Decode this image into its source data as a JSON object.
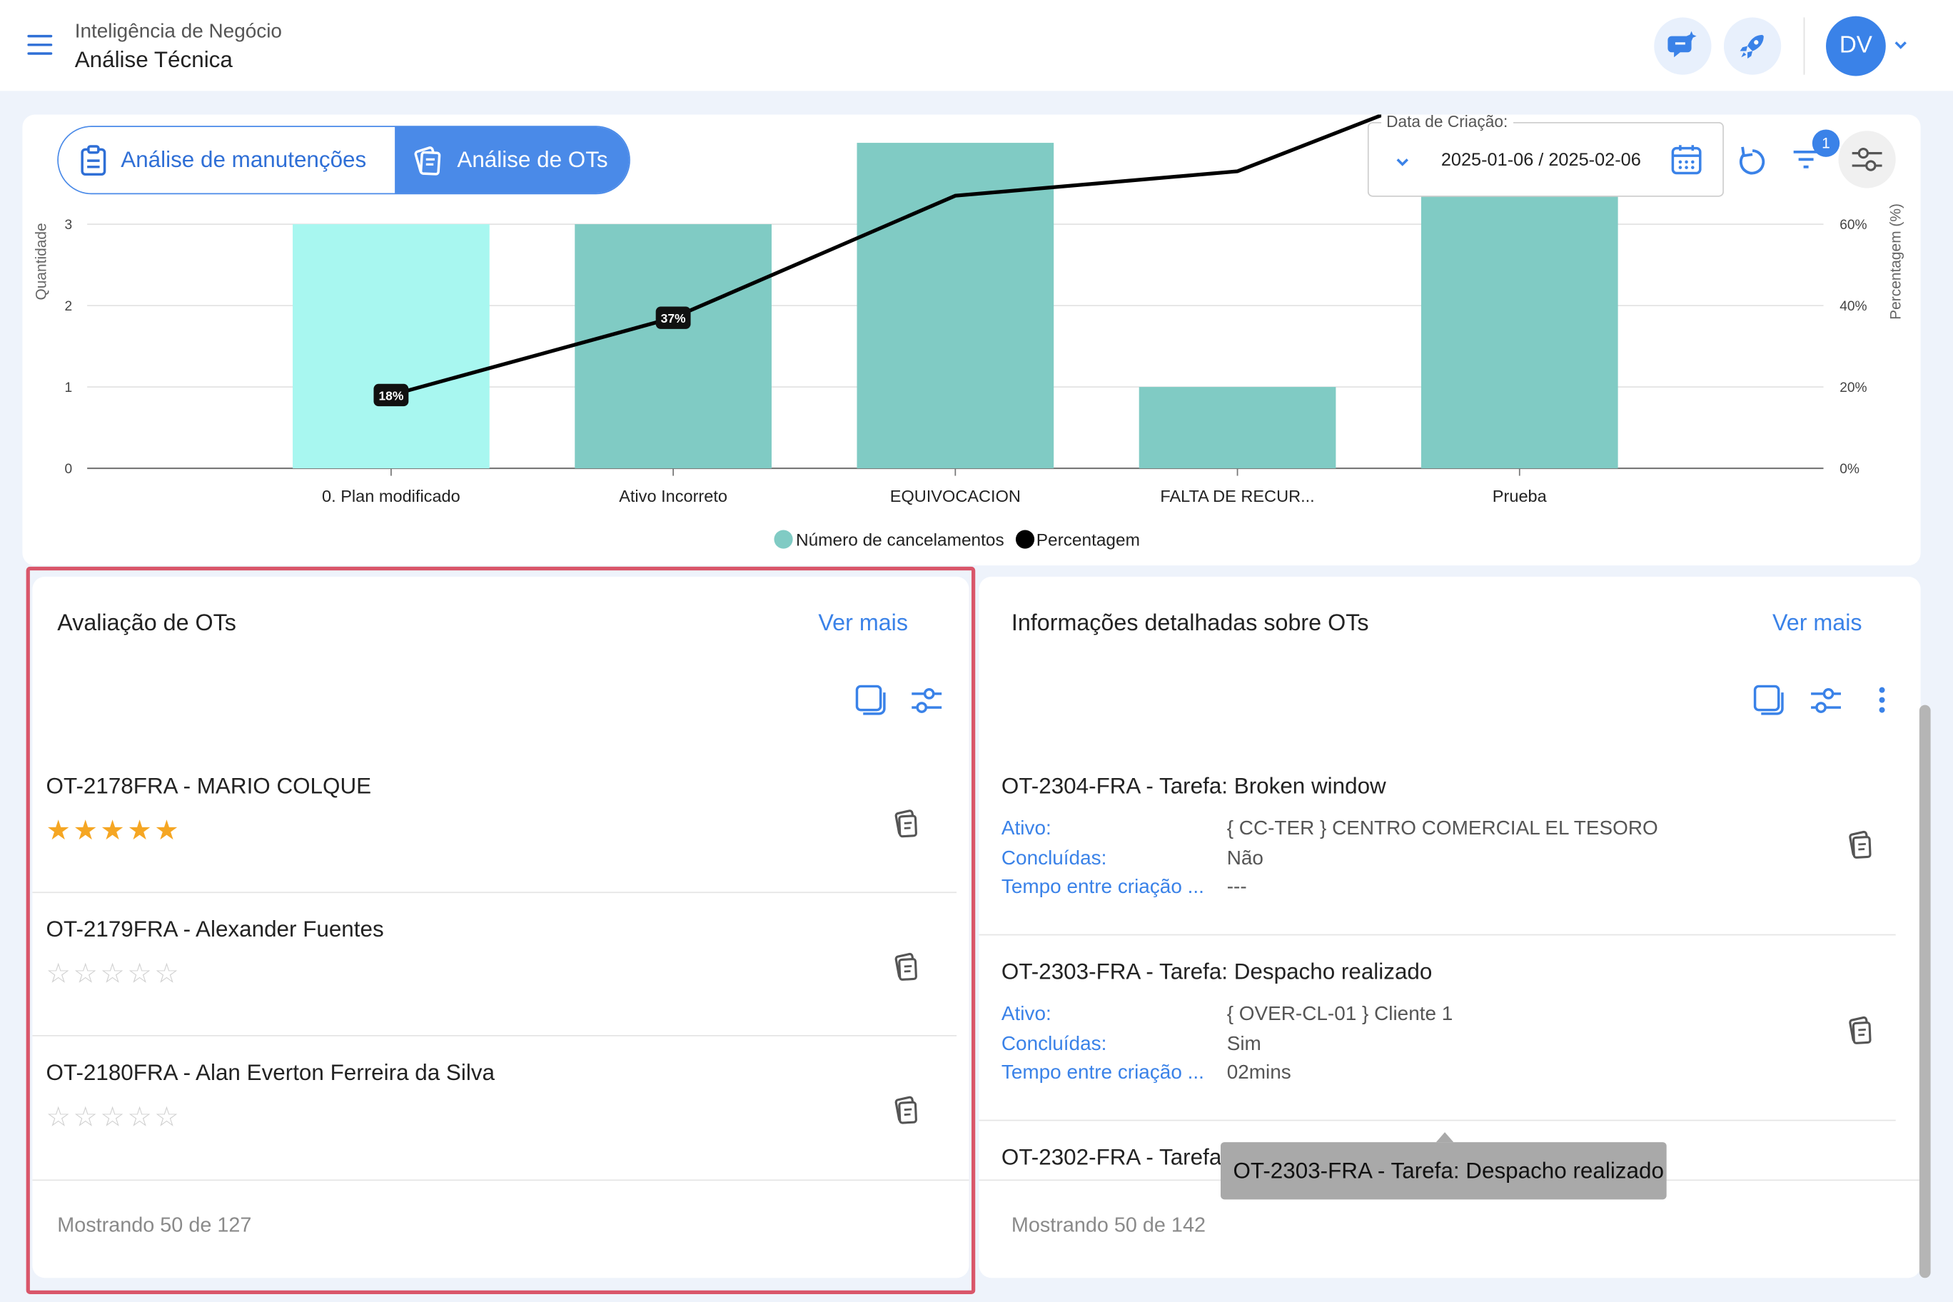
{
  "header": {
    "breadcrumb_parent": "Inteligência de Negócio",
    "breadcrumb_current": "Análise Técnica",
    "avatar_initials": "DV"
  },
  "tabs": [
    {
      "label": "Análise de manutenções",
      "active": false
    },
    {
      "label": "Análise de OTs",
      "active": true
    }
  ],
  "date_filter": {
    "label": "Data de Criação:",
    "value": "2025-01-06 / 2025-02-06"
  },
  "filter_badge": "1",
  "chart_data": {
    "type": "bar",
    "categories": [
      "0. Plan modificado",
      "Ativo Incorreto",
      "EQUIVOCACION",
      "FALTA DE RECUR...",
      "Prueba"
    ],
    "series": [
      {
        "name": "Número de cancelamentos",
        "type": "bar",
        "values": [
          3,
          3,
          4,
          1,
          4
        ],
        "color": "#80cbc4",
        "highlight_color": "#a8f7f0"
      },
      {
        "name": "Percentagem",
        "type": "line",
        "values": [
          18,
          37,
          67,
          73,
          100
        ],
        "color": "#000000"
      }
    ],
    "point_labels": [
      "18%",
      "37%"
    ],
    "ylabel": "Quantidade",
    "y2label": "Percentagem (%)",
    "yticks": [
      "0",
      "1",
      "2",
      "3"
    ],
    "y2ticks": [
      "0%",
      "20%",
      "40%",
      "60%"
    ],
    "ylim": [
      0,
      3
    ],
    "y2lim": [
      0,
      60
    ]
  },
  "left_panel": {
    "title": "Avaliação de OTs",
    "ver_mais": "Ver mais",
    "items": [
      {
        "title": "OT-2178FRA - MARIO COLQUE",
        "rating": 5
      },
      {
        "title": "OT-2179FRA - Alexander Fuentes",
        "rating": 0
      },
      {
        "title": "OT-2180FRA - Alan Everton Ferreira da Silva",
        "rating": 0
      }
    ],
    "footer": "Mostrando 50 de 127"
  },
  "right_panel": {
    "title": "Informações detalhadas sobre OTs",
    "ver_mais": "Ver mais",
    "field_labels": {
      "ativo": "Ativo:",
      "concluidas": "Concluídas:",
      "tempo": "Tempo entre criação ..."
    },
    "items": [
      {
        "title": "OT-2304-FRA - Tarefa: Broken window",
        "ativo": "{ CC-TER } CENTRO COMERCIAL EL TESORO",
        "concluidas": "Não",
        "tempo": "---"
      },
      {
        "title": "OT-2303-FRA - Tarefa: Despacho realizado",
        "ativo": "{ OVER-CL-01 } Cliente 1",
        "concluidas": "Sim",
        "tempo": "02mins"
      },
      {
        "title": "OT-2302-FRA - Tarefa:"
      }
    ],
    "footer": "Mostrando 50 de 142",
    "tooltip": "OT-2303-FRA - Tarefa: Despacho realizado"
  },
  "icons": {
    "menu": "menu-icon",
    "chat": "chat-sparkle-icon",
    "rocket": "rocket-icon",
    "clipboard": "clipboard-icon",
    "workorder": "workorder-tags-icon",
    "calendar": "calendar-icon",
    "refresh": "refresh-icon",
    "filter": "filter-icon",
    "settings": "sliders-icon"
  },
  "colors": {
    "accent": "#3a82e8",
    "highlight_border": "#d9566a",
    "star": "#f5a623"
  }
}
